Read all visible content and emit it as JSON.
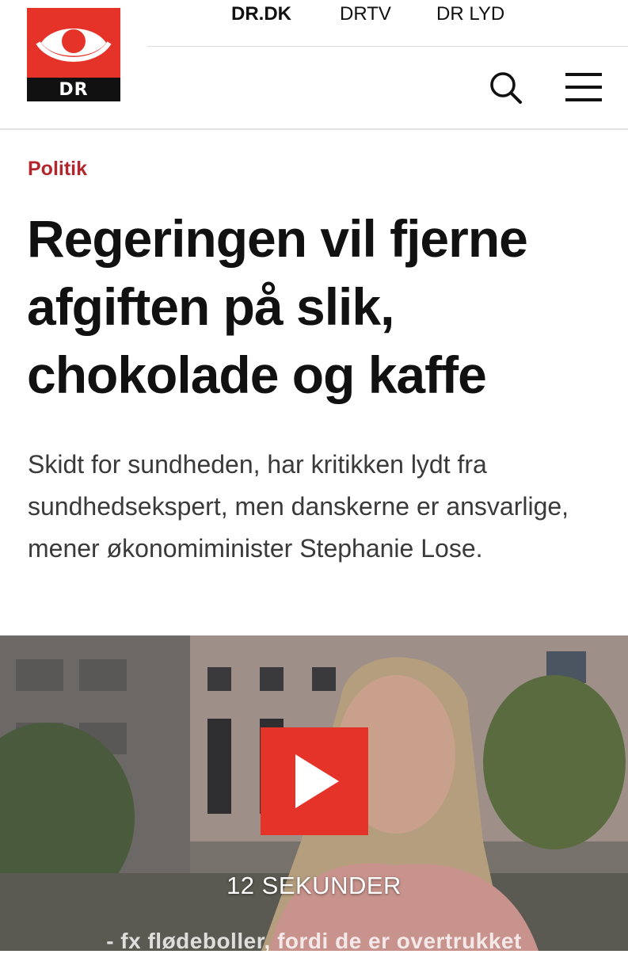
{
  "header": {
    "logo_text": "DR",
    "nav": {
      "dr_dk": "DR.DK",
      "drtv": "DRTV",
      "dr_lyd": "DR LYD"
    },
    "icons": {
      "search": "search-icon",
      "menu": "hamburger-menu-icon"
    },
    "brand_color": "#e6332a"
  },
  "article": {
    "kicker": "Politik",
    "kicker_color": "#b3262d",
    "headline": "Regeringen vil fjerne afgiften på slik, chokolade og kaffe",
    "summary": "Skidt for sundheden, har kritikken lydt fra sundhedsekspert, men danskerne er ansvarlige, mener økonomiminister Stephanie Lose."
  },
  "video": {
    "duration_label": "12 SEKUNDER",
    "subtitle": "- fx flødeboller, fordi de er overtrukket",
    "play_icon": "play-icon"
  }
}
